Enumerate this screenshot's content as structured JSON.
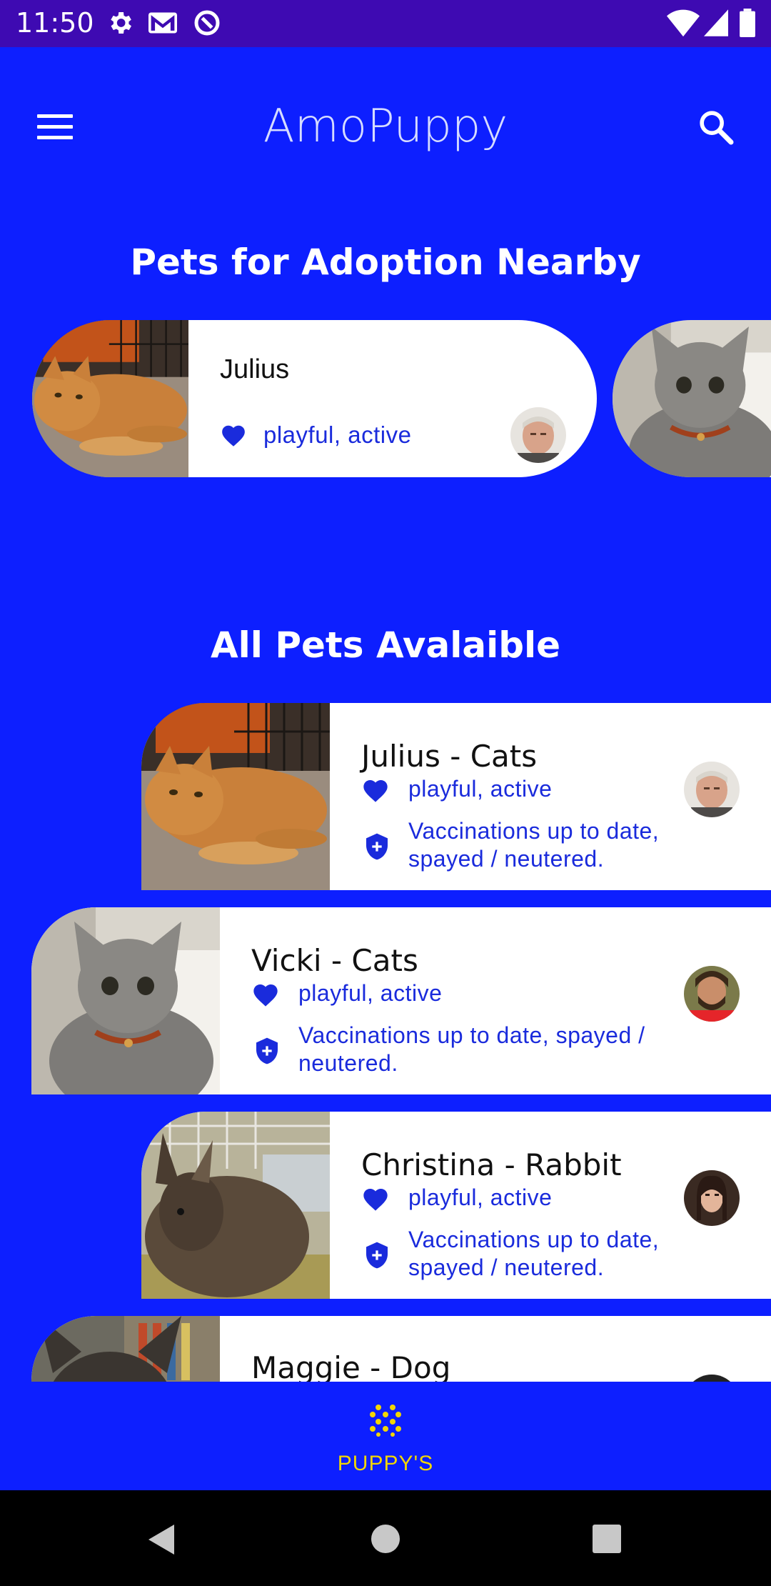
{
  "status_bar": {
    "time": "11:50",
    "background": "#3e0ab2",
    "icons": [
      "settings-icon",
      "gmail-icon",
      "sync-icon",
      "wifi-icon",
      "signal-icon",
      "battery-icon"
    ]
  },
  "app_bar": {
    "title": "AmoPuppy",
    "menu_icon": "menu-icon",
    "search_icon": "search-icon"
  },
  "nearby": {
    "title": "Pets for Adoption Nearby",
    "featured": {
      "name": "Julius",
      "tags": "playful, active",
      "photo": "orange-cat-photo",
      "owner_avatar": "elderly-man-avatar"
    },
    "next_card_photo": "gray-cat-photo"
  },
  "all_pets": {
    "title": "All Pets Avalaible",
    "items": [
      {
        "name": "Julius - Cats",
        "tags": "playful, active",
        "vaccination_line1": "Vaccinations up to date,",
        "vaccination_line2": "spayed / neutered.",
        "photo": "orange-cat-photo",
        "owner_avatar": "elderly-man-avatar"
      },
      {
        "name": "Vicki - Cats",
        "tags": "playful, active",
        "vaccination_line1": "Vaccinations up to date, spayed /",
        "vaccination_line2": "neutered.",
        "photo": "gray-cat-photo",
        "owner_avatar": "bearded-man-avatar"
      },
      {
        "name": "Christina - Rabbit",
        "tags": "playful, active",
        "vaccination_line1": "Vaccinations up to date,",
        "vaccination_line2": "spayed / neutered.",
        "photo": "rabbit-photo",
        "owner_avatar": "woman-avatar"
      },
      {
        "name": "Maggie - Dog",
        "photo": "dog-photo",
        "owner_avatar": "dark-avatar"
      }
    ]
  },
  "bottom_nav": {
    "label": "PUPPY'S",
    "icon": "dots-grid-icon",
    "active_color": "#f2d600"
  },
  "system_nav": {
    "buttons": [
      "back-button",
      "home-button",
      "recents-button"
    ]
  },
  "colors": {
    "background": "#0d1fff",
    "accent_text": "#1a2bdc",
    "card": "#ffffff"
  }
}
